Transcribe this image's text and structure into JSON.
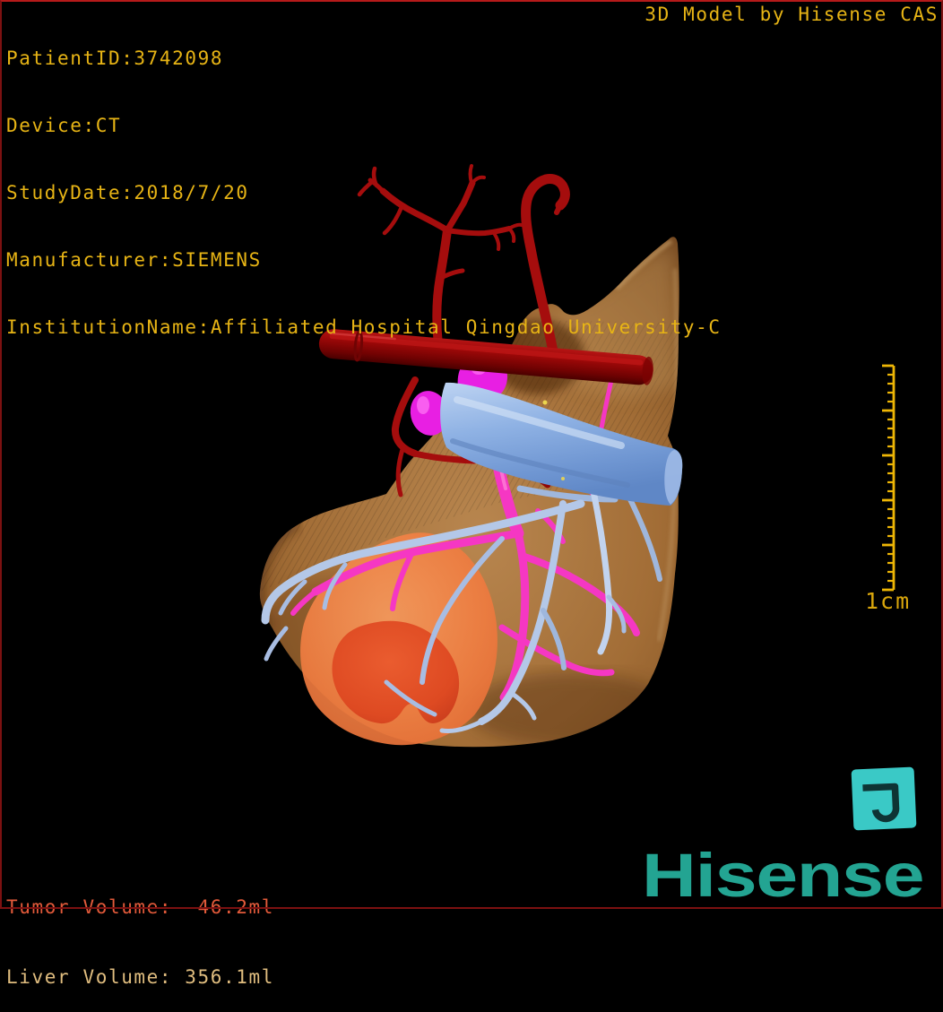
{
  "header": {
    "lines": [
      "PatientID:3742098",
      "Device:CT",
      "StudyDate:2018/7/20",
      "Manufacturer:SIEMENS",
      "InstitutionName:Affiliated Hospital Qingdao University-C"
    ],
    "model_title": "3D Model by Hisense CAS"
  },
  "volumes": {
    "tumor": {
      "label": "Tumor Volume:",
      "value": "46.2ml"
    },
    "liver": {
      "label": "Liver Volume:",
      "value": "356.1ml"
    }
  },
  "scale_bar": {
    "label": "1cm",
    "major_divisions": 5,
    "minor_per_major": 5,
    "pixels_per_major": 50
  },
  "branding": {
    "logo": "Hisense"
  },
  "model": {
    "structures": {
      "liver": "translucent brown organ body",
      "tumor": "orange lesion lower left lobe",
      "hepatic_artery": "dark red branching tree and aorta tube",
      "portal_vein": "bright pink branches",
      "hepatic_veins": "pale blue branches",
      "inferior_vena_cava": "thick steel-blue tube"
    }
  },
  "colors": {
    "overlay_text": "#e7b415",
    "tumor_text": "#e25a3a",
    "liver_text": "#e0bd7f",
    "scale": "#d9a60c",
    "ruler": "#eeb605",
    "logo": "#23a492",
    "icon": "#3ac9c6",
    "border": "#7c1111",
    "liver": "#a26d36",
    "tumor": "#e8562e",
    "artery": "#a50d0d",
    "portal_vein": "#f537c3",
    "hepatic_vein": "#b4c8e8",
    "ivc": "#8fb2e4",
    "background": "#000000"
  }
}
